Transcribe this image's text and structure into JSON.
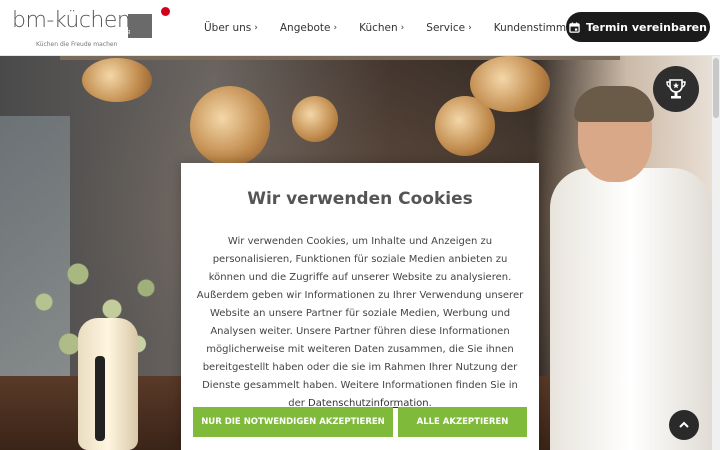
{
  "header": {
    "logo": {
      "brand": "bm-küchen",
      "suffix": "ag",
      "tagline": "Küchen die Freude machen"
    },
    "nav": [
      {
        "label": "Über uns",
        "chevron": "›"
      },
      {
        "label": "Angebote",
        "chevron": "›"
      },
      {
        "label": "Küchen",
        "chevron": "›"
      },
      {
        "label": "Service",
        "chevron": "›"
      },
      {
        "label": "Kundenstimmen",
        "chevron": ""
      }
    ],
    "cta": {
      "label": "Termin vereinbaren",
      "icon": "calendar-icon"
    }
  },
  "hero": {
    "badge_icon": "trophy-icon"
  },
  "cookie_modal": {
    "title": "Wir verwenden Cookies",
    "body": "Wir verwenden Cookies, um Inhalte und Anzeigen zu personalisieren, Funktionen für soziale Medien anbieten zu können und die Zugriffe auf unserer Website zu analysieren. Außerdem geben wir Informationen zu Ihrer Verwendung unserer Website an unsere Partner für soziale Medien, Werbung und Analysen weiter. Unsere Partner führen diese Informationen möglicherweise mit weiteren Daten zusammen, die Sie ihnen bereitgestellt haben oder die sie im Rahmen Ihrer Nutzung der Dienste gesammelt haben. Weitere Informationen finden Sie in der",
    "link": "Datenschutzinformation",
    "link_suffix": ".",
    "btn_necessary": "NUR DIE NOTWENDIGEN AKZEPTIEREN",
    "btn_all": "ALLE AKZEPTIEREN"
  },
  "scroll_top_icon": "chevron-up-icon",
  "colors": {
    "accent_green": "#7fba3a",
    "dark": "#1b1b1b",
    "logo_red": "#d0021b"
  }
}
